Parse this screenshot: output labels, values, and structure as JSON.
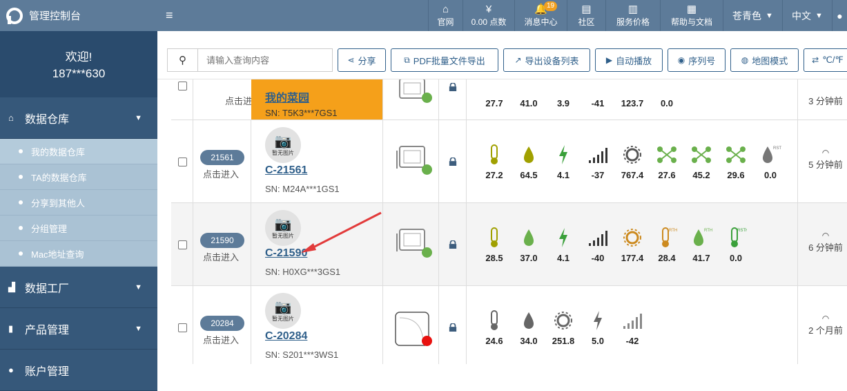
{
  "header": {
    "brand": "管理控制台",
    "nav": [
      {
        "label": "官网",
        "icon": "home-icon"
      },
      {
        "label": "0.00 点数",
        "icon": "money-bag-icon"
      },
      {
        "label": "消息中心",
        "icon": "bell-icon",
        "badge": "19"
      },
      {
        "label": "社区",
        "icon": "chat-icon"
      },
      {
        "label": "服务价格",
        "icon": "book-icon"
      },
      {
        "label": "帮助与文档",
        "icon": "doc-icon"
      }
    ],
    "theme": "苍青色",
    "language": "中文"
  },
  "sidebar": {
    "welcome": "欢迎!",
    "user": "187***630",
    "menus": [
      {
        "label": "数据仓库",
        "icon": "home-icon"
      },
      {
        "label": "数据工厂",
        "icon": "chart-icon"
      },
      {
        "label": "产品管理",
        "icon": "bookmark-icon"
      },
      {
        "label": "账户管理",
        "icon": "user-icon"
      }
    ],
    "sub_items": [
      "我的数据仓库",
      "TA的数据仓库",
      "分享到其他人",
      "分组管理",
      "Mac地址查询"
    ]
  },
  "toolbar": {
    "search_placeholder": "请输入查询内容",
    "buttons": [
      "分享",
      "PDF批量文件导出",
      "导出设备列表",
      "自动播放",
      "序列号",
      "地图模式",
      "℃/℉"
    ]
  },
  "rows": [
    {
      "id": "",
      "enter": "点击进入",
      "name": "我的菜园",
      "sn": "SN: T5K3***7GS1",
      "status_color": "#6ab04c",
      "highlight": true,
      "values": [
        "27.7",
        "41.0",
        "3.9",
        "-41",
        "123.7",
        "0.0"
      ],
      "last": "3 分钟前"
    },
    {
      "id": "21561",
      "enter": "点击进入",
      "thumb": "暂无图片",
      "name": "C-21561",
      "sn": "SN: M24A***1GS1",
      "status_color": "#6ab04c",
      "values": [
        "27.2",
        "64.5",
        "4.1",
        "-37",
        "767.4",
        "27.6",
        "45.2",
        "29.6",
        "0.0"
      ],
      "last": "5 分钟前"
    },
    {
      "id": "21590",
      "enter": "点击进入",
      "thumb": "暂无图片",
      "name": "C-21590",
      "sn": "SN: H0XG***3GS1",
      "status_color": "#6ab04c",
      "values": [
        "28.5",
        "37.0",
        "4.1",
        "-40",
        "177.4",
        "28.4",
        "41.7",
        "0.0"
      ],
      "last": "6 分钟前"
    },
    {
      "id": "20284",
      "enter": "点击进入",
      "thumb": "暂无图片",
      "name": "C-20284",
      "sn": "SN: S201***3WS1",
      "status_color": "#e8110f",
      "values": [
        "24.6",
        "34.0",
        "251.8",
        "5.0",
        "-42"
      ],
      "last": "2 个月前"
    }
  ],
  "colors": {
    "header": "#5d7b99",
    "accent": "#2f5f8a",
    "highlight": "#f5a01a",
    "online": "#6ab04c",
    "offline": "#e8110f",
    "olive": "#a0a000",
    "green": "#6ab04c",
    "orange": "#cc8a1f",
    "grey": "#666666"
  }
}
